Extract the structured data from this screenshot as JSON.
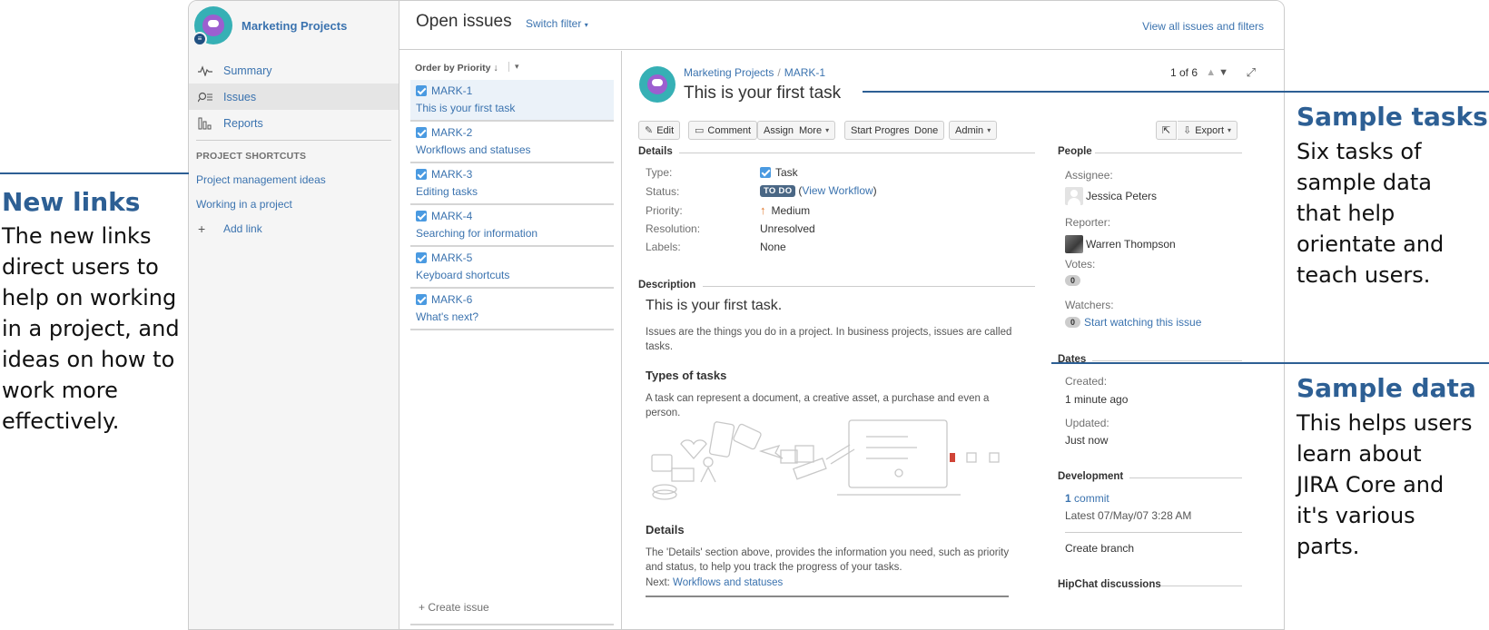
{
  "sidebar": {
    "project_name": "Marketing Projects",
    "nav": [
      {
        "label": "Summary",
        "icon": "activity-icon"
      },
      {
        "label": "Issues",
        "icon": "issues-icon"
      },
      {
        "label": "Reports",
        "icon": "chart-icon"
      }
    ],
    "shortcuts_title": "PROJECT SHORTCUTS",
    "shortcuts": [
      "Project management ideas",
      "Working in a project"
    ],
    "add_link": "Add link"
  },
  "header": {
    "title": "Open issues",
    "switch_filter": "Switch filter",
    "view_all": "View all issues and filters"
  },
  "list": {
    "order_by": "Order by Priority",
    "issues": [
      {
        "key": "MARK-1",
        "summary": "This is your first task"
      },
      {
        "key": "MARK-2",
        "summary": "Workflows and statuses"
      },
      {
        "key": "MARK-3",
        "summary": "Editing tasks"
      },
      {
        "key": "MARK-4",
        "summary": "Searching for information"
      },
      {
        "key": "MARK-5",
        "summary": "Keyboard shortcuts"
      },
      {
        "key": "MARK-6",
        "summary": "What's next?"
      }
    ],
    "create_issue": "+ Create issue"
  },
  "detail": {
    "breadcrumb_project": "Marketing Projects",
    "breadcrumb_sep": "/",
    "breadcrumb_key": "MARK-1",
    "title": "This is your first task",
    "pager": "1 of 6",
    "toolbar": {
      "edit": "Edit",
      "comment": "Comment",
      "assign": "Assign",
      "more": "More",
      "start_progress": "Start Progress",
      "done": "Done",
      "admin": "Admin",
      "export": "Export"
    },
    "details_title": "Details",
    "fields": {
      "type_label": "Type:",
      "type_value": "Task",
      "status_label": "Status:",
      "status_value": "TO DO",
      "view_workflow": "View Workflow",
      "priority_label": "Priority:",
      "priority_value": "Medium",
      "resolution_label": "Resolution:",
      "resolution_value": "Unresolved",
      "labels_label": "Labels:",
      "labels_value": "None"
    },
    "description": {
      "title": "Description",
      "heading": "This is your first task.",
      "p1": "Issues are the things you do in a project. In business projects, issues are called tasks.",
      "types_heading": "Types of tasks",
      "p2": "A task can represent a document, a creative asset, a purchase and even a person.",
      "details_heading": "Details",
      "p3": "The 'Details' section above, provides the information you need, such as priority and status, to help you track the progress of your tasks.",
      "next_label": "Next:",
      "next_link": "Workflows and statuses"
    },
    "people": {
      "title": "People",
      "assignee_label": "Assignee:",
      "assignee": "Jessica Peters",
      "reporter_label": "Reporter:",
      "reporter": "Warren Thompson",
      "votes_label": "Votes:",
      "votes": "0",
      "watchers_label": "Watchers:",
      "watchers": "0",
      "watch_link": "Start watching this issue"
    },
    "dates": {
      "title": "Dates",
      "created_label": "Created:",
      "created": "1 minute ago",
      "updated_label": "Updated:",
      "updated": "Just now"
    },
    "development": {
      "title": "Development",
      "commit_count": "1",
      "commit_label": "commit",
      "latest": "Latest 07/May/07 3:28 AM",
      "create_branch": "Create branch"
    },
    "hipchat_title": "HipChat discussions"
  },
  "annotations": {
    "new_links": {
      "title": "New links",
      "body": [
        "The new links",
        "direct users to",
        "help on working",
        "in a project, and",
        "ideas on how to",
        "work more",
        "effectively."
      ]
    },
    "sample_tasks": {
      "title": "Sample tasks",
      "body": [
        "Six tasks of",
        "sample data",
        "that help",
        "orientate and",
        "teach users."
      ]
    },
    "sample_data": {
      "title": "Sample data",
      "body": [
        "This helps users",
        "learn about",
        "JIRA Core and",
        "it's various",
        "parts."
      ]
    }
  },
  "colors": {
    "link": "#3b73af",
    "annotation": "#2d5f94",
    "status_lozenge": "#4a6785",
    "selected_row": "#ebf2f9"
  }
}
